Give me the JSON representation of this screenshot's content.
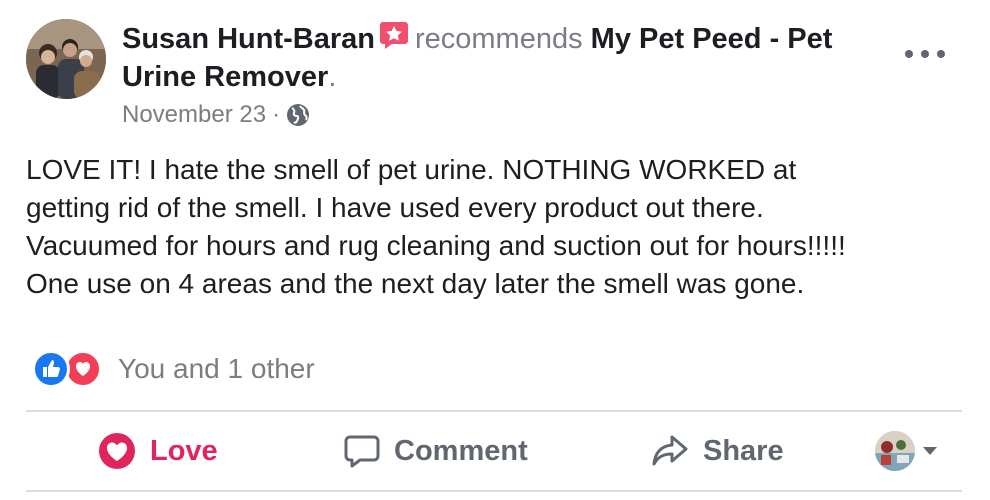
{
  "post": {
    "author": "Susan Hunt-Baran",
    "recommends_text": "recommends",
    "page_name": "My Pet Peed - Pet Urine Remover",
    "page_suffix": ".",
    "date": "November 23",
    "separator": "·",
    "body": "LOVE IT!  I hate the smell of pet urine.  NOTHING WORKED at\ngetting rid of the smell. I have used every product out there.\nVacuumed for hours and rug cleaning and suction out for hours!!!!!\nOne use on 4 areas and the next day later the smell was gone."
  },
  "reactions": {
    "summary": "You and 1 other",
    "types": [
      "like",
      "love"
    ]
  },
  "actions": {
    "love_label": "Love",
    "comment_label": "Comment",
    "share_label": "Share"
  },
  "icons": {
    "recommend_badge": "recommend-star-badge-icon",
    "privacy": "globe-icon",
    "more": "more-options-icon",
    "like": "thumbs-up-icon",
    "love": "heart-icon",
    "comment": "comment-bubble-icon",
    "share": "share-arrow-icon"
  },
  "colors": {
    "love_red": "#e0245e",
    "like_blue": "#1877f2",
    "badge_pink": "#f0506e",
    "secondary_text": "#7a7d82"
  }
}
